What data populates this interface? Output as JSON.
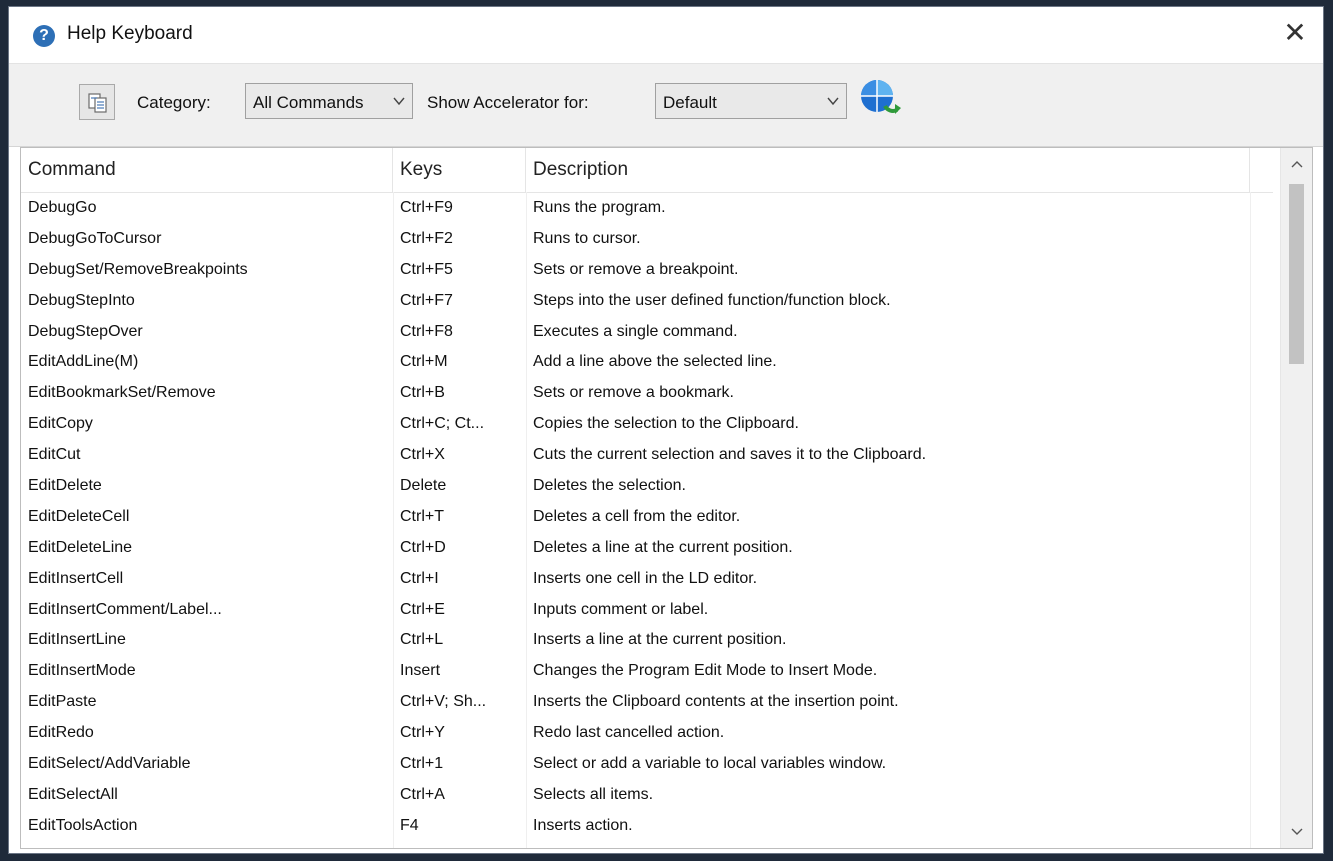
{
  "window": {
    "title": "Help Keyboard"
  },
  "toolbar": {
    "category_label": "Category:",
    "category_value": "All Commands",
    "show_accel_label": "Show Accelerator for:",
    "show_accel_value": "Default"
  },
  "table": {
    "headers": {
      "command": "Command",
      "keys": "Keys",
      "description": "Description"
    },
    "rows": [
      {
        "command": "DebugGo",
        "keys": "Ctrl+F9",
        "description": "Runs the program."
      },
      {
        "command": "DebugGoToCursor",
        "keys": "Ctrl+F2",
        "description": "Runs to cursor."
      },
      {
        "command": "DebugSet/RemoveBreakpoints",
        "keys": "Ctrl+F5",
        "description": "Sets or remove a breakpoint."
      },
      {
        "command": "DebugStepInto",
        "keys": "Ctrl+F7",
        "description": "Steps into the user defined function/function block."
      },
      {
        "command": "DebugStepOver",
        "keys": "Ctrl+F8",
        "description": "Executes a single command."
      },
      {
        "command": "EditAddLine(M)",
        "keys": "Ctrl+M",
        "description": "Add a line above the selected line."
      },
      {
        "command": "EditBookmarkSet/Remove",
        "keys": "Ctrl+B",
        "description": "Sets or remove a bookmark."
      },
      {
        "command": "EditCopy",
        "keys": "Ctrl+C; Ct...",
        "description": "Copies the selection to the Clipboard."
      },
      {
        "command": "EditCut",
        "keys": "Ctrl+X",
        "description": "Cuts the current selection and saves it to the Clipboard."
      },
      {
        "command": "EditDelete",
        "keys": "Delete",
        "description": "Deletes the selection."
      },
      {
        "command": "EditDeleteCell",
        "keys": "Ctrl+T",
        "description": "Deletes a cell from the editor."
      },
      {
        "command": "EditDeleteLine",
        "keys": "Ctrl+D",
        "description": "Deletes a line at the current position."
      },
      {
        "command": "EditInsertCell",
        "keys": "Ctrl+I",
        "description": "Inserts one cell in the LD editor."
      },
      {
        "command": "EditInsertComment/Label...",
        "keys": "Ctrl+E",
        "description": "Inputs comment or label."
      },
      {
        "command": "EditInsertLine",
        "keys": "Ctrl+L",
        "description": "Inserts a line at the current position."
      },
      {
        "command": "EditInsertMode",
        "keys": "Insert",
        "description": "Changes the Program Edit Mode to Insert Mode."
      },
      {
        "command": "EditPaste",
        "keys": "Ctrl+V; Sh...",
        "description": "Inserts the Clipboard contents at the insertion point."
      },
      {
        "command": "EditRedo",
        "keys": "Ctrl+Y",
        "description": "Redo last cancelled action."
      },
      {
        "command": "EditSelect/AddVariable",
        "keys": "Ctrl+1",
        "description": "Select or add a variable to local variables window."
      },
      {
        "command": "EditSelectAll",
        "keys": "Ctrl+A",
        "description": "Selects all items."
      },
      {
        "command": "EditToolsAction",
        "keys": "F4",
        "description": "Inserts action."
      }
    ]
  },
  "icons": {
    "title": "help-icon",
    "close": "close-icon",
    "copy": "copy-icon",
    "refresh": "refresh-globe-icon"
  }
}
